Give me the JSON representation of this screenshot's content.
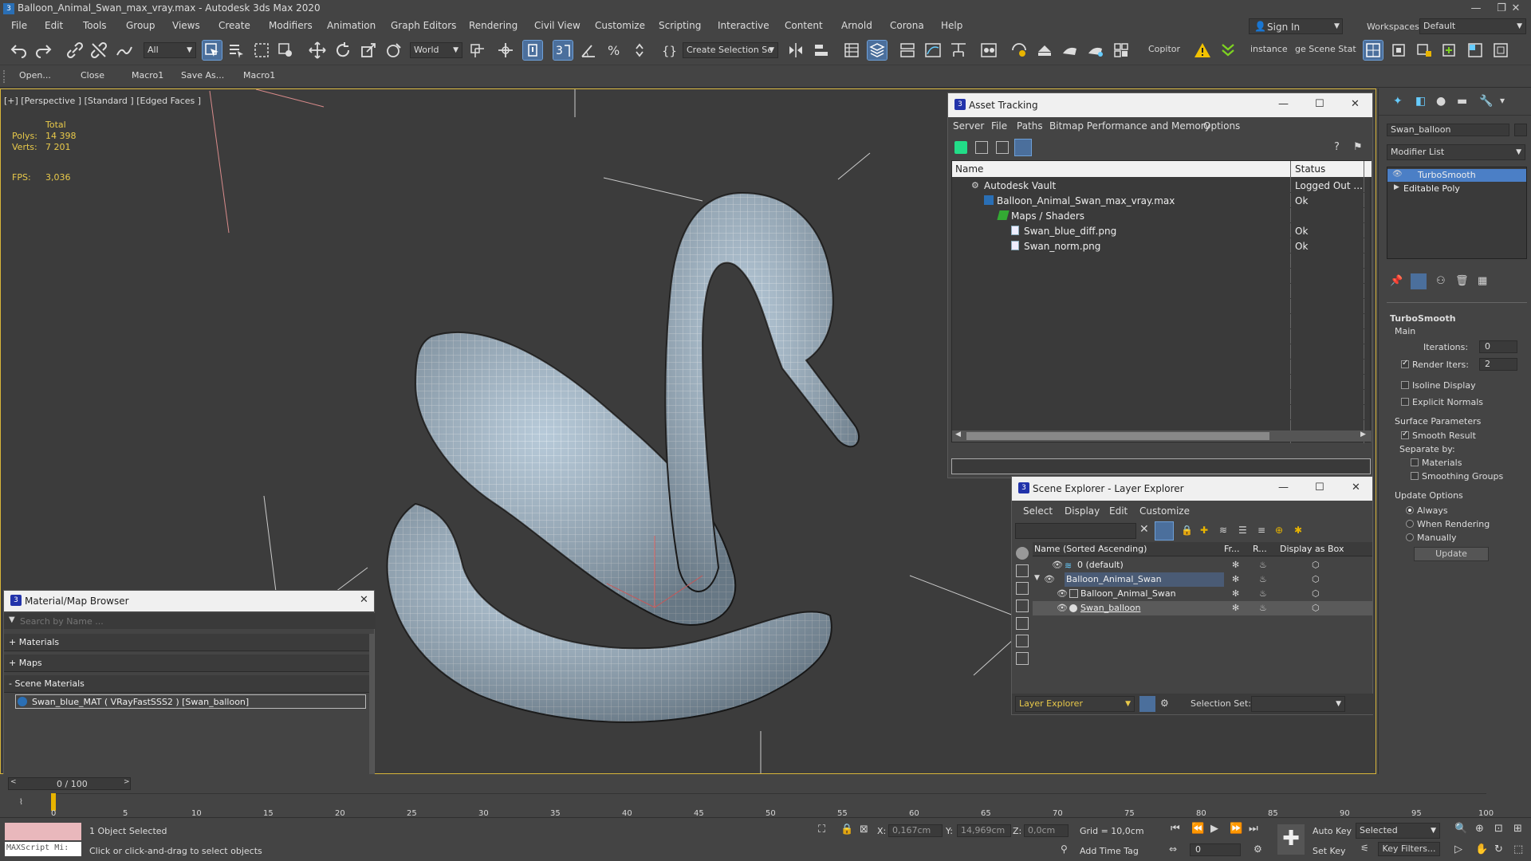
{
  "window": {
    "title": "Balloon_Animal_Swan_max_vray.max - Autodesk 3ds Max 2020"
  },
  "menu": [
    "File",
    "Edit",
    "Tools",
    "Group",
    "Views",
    "Create",
    "Modifiers",
    "Animation",
    "Graph Editors",
    "Rendering",
    "Civil View",
    "Customize",
    "Scripting",
    "Interactive",
    "Content",
    "Arnold",
    "Corona",
    "Help"
  ],
  "account": {
    "sign_in": "Sign In",
    "workspaces_label": "Workspaces:",
    "workspace": "Default"
  },
  "toolbar": {
    "filter": "All",
    "coord": "World",
    "selection_set": "Create Selection Se",
    "copitor": "Copitor",
    "instance": "instance",
    "scene_stat": "ge Scene Stat"
  },
  "macros": [
    "Open...",
    "Close",
    "Macro1",
    "Save As...",
    "Macro1"
  ],
  "viewport": {
    "label": "[+] [Perspective ] [Standard ] [Edged Faces ]",
    "stats": {
      "total": "Total",
      "polys_label": "Polys:",
      "polys": "14 398",
      "verts_label": "Verts:",
      "verts": "7 201",
      "fps_label": "FPS:",
      "fps": "3,036"
    }
  },
  "asset_tracking": {
    "title": "Asset Tracking",
    "menu": [
      "Server",
      "File",
      "Paths",
      "Bitmap Performance and Memory",
      "Options"
    ],
    "columns": [
      "Name",
      "Status"
    ],
    "rows": [
      {
        "name": "Autodesk Vault",
        "status": "Logged Out ..."
      },
      {
        "name": "Balloon_Animal_Swan_max_vray.max",
        "status": "Ok"
      },
      {
        "name": "Maps / Shaders",
        "status": ""
      },
      {
        "name": "Swan_blue_diff.png",
        "status": "Ok"
      },
      {
        "name": "Swan_norm.png",
        "status": "Ok"
      }
    ]
  },
  "scene_explorer": {
    "title": "Scene Explorer - Layer Explorer",
    "menu": [
      "Select",
      "Display",
      "Edit",
      "Customize"
    ],
    "columns": [
      "Name (Sorted Ascending)",
      "Fr...",
      "R...",
      "Display as Box"
    ],
    "rows": [
      "0 (default)",
      "Balloon_Animal_Swan",
      "Balloon_Animal_Swan",
      "Swan_balloon"
    ],
    "footer_explorer": "Layer Explorer",
    "selection_set_label": "Selection Set:"
  },
  "material_browser": {
    "title": "Material/Map Browser",
    "search_placeholder": "Search by Name ...",
    "sections": [
      "+ Materials",
      "+ Maps",
      "- Scene Materials"
    ],
    "material": "Swan_blue_MAT  ( VRayFastSSS2 )  [Swan_balloon]"
  },
  "command_panel": {
    "object_name": "Swan_balloon",
    "modifier_list": "Modifier List",
    "stack": [
      "TurboSmooth",
      "Editable Poly"
    ],
    "turbosmooth": {
      "header": "TurboSmooth",
      "main": "Main",
      "iterations_label": "Iterations:",
      "iterations": "0",
      "render_iters_label": "Render Iters:",
      "render_iters": "2",
      "isoline": "Isoline Display",
      "explicit_normals": "Explicit Normals",
      "surface_params": "Surface Parameters",
      "smooth_result": "Smooth Result",
      "separate_by": "Separate by:",
      "materials": "Materials",
      "smoothing_groups": "Smoothing Groups",
      "update_options": "Update Options",
      "always": "Always",
      "when_rendering": "When Rendering",
      "manually": "Manually",
      "update": "Update"
    }
  },
  "timeline": {
    "frame": "0 / 100",
    "ticks": [
      "0",
      "5",
      "10",
      "15",
      "20",
      "25",
      "30",
      "35",
      "40",
      "45",
      "50",
      "55",
      "60",
      "65",
      "70",
      "75",
      "80",
      "85",
      "90",
      "95",
      "100"
    ]
  },
  "status": {
    "maxscript": "MAXScript Mi:",
    "selected": "1 Object Selected",
    "prompt": "Click or click-and-drag to select objects",
    "x_label": "X:",
    "x": "0,167cm",
    "y_label": "Y:",
    "y": "14,969cm",
    "z_label": "Z:",
    "z": "0,0cm",
    "grid": "Grid = 10,0cm",
    "add_time_tag": "Add Time Tag",
    "auto_key": "Auto Key",
    "selected_mode": "Selected",
    "set_key": "Set Key",
    "key_filters": "Key Filters...",
    "frame_field": "0"
  }
}
